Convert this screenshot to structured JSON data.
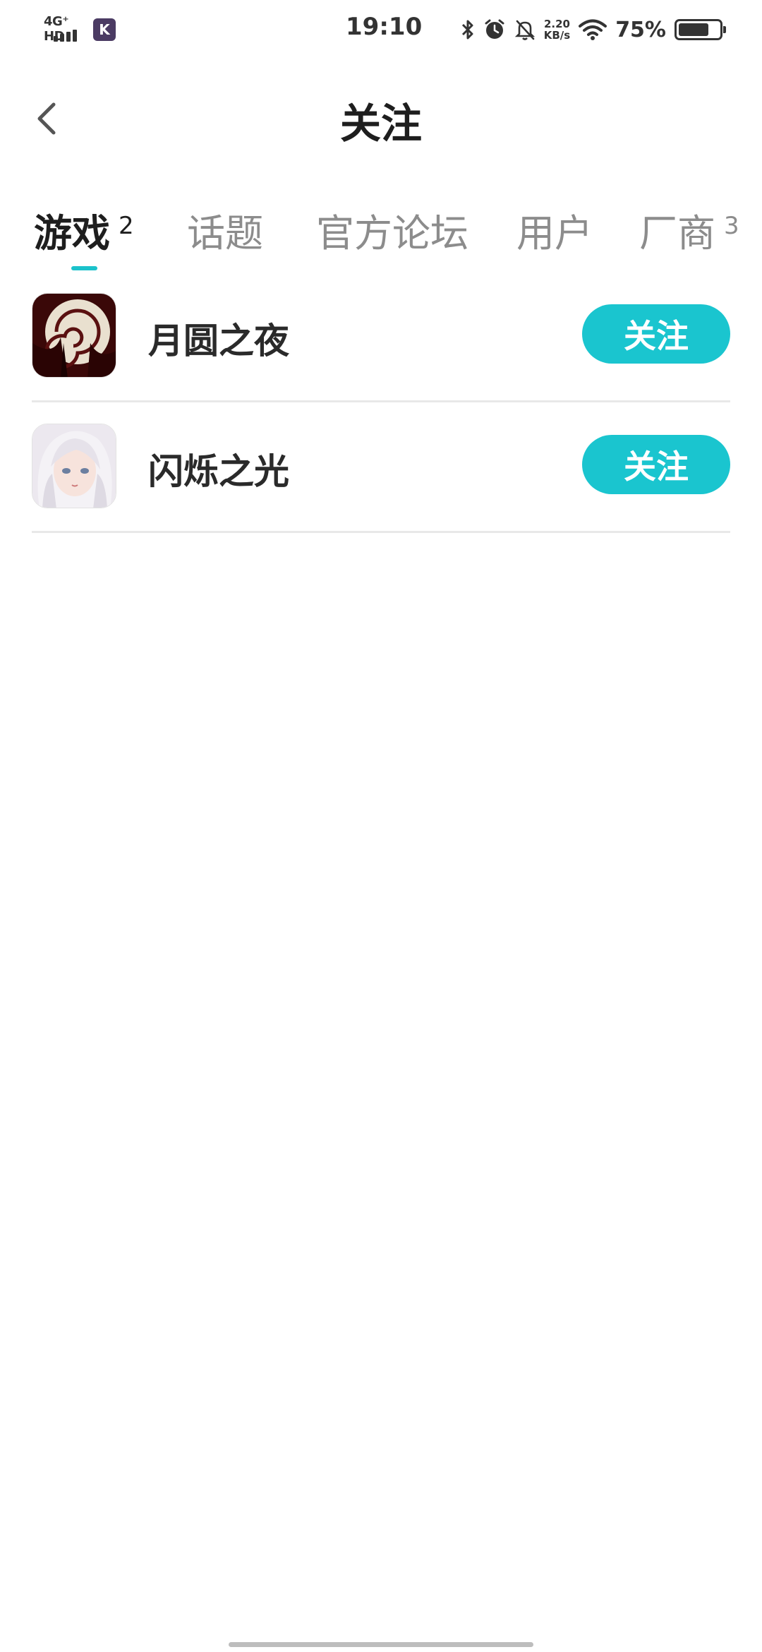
{
  "status_bar": {
    "network": "4G⁺ HD",
    "app_letter": "K",
    "time": "19:10",
    "speed_value": "2.20",
    "speed_unit": "KB/s",
    "battery_pct": "75%",
    "battery_level": 0.75
  },
  "header": {
    "title": "关注"
  },
  "tabs": [
    {
      "label": "游戏",
      "count": "2",
      "active": true
    },
    {
      "label": "话题"
    },
    {
      "label": "官方论坛"
    },
    {
      "label": "用户"
    },
    {
      "label": "厂商",
      "count": "3"
    }
  ],
  "games": [
    {
      "name": "月圆之夜",
      "button": "关注",
      "icon": "moon-night-game-icon"
    },
    {
      "name": "闪烁之光",
      "button": "关注",
      "icon": "anime-girl-game-icon"
    }
  ],
  "colors": {
    "accent": "#1ac5cf",
    "text_primary": "#1e1e1e",
    "text_secondary": "#8c8c8c",
    "divider": "#e8e8e8"
  }
}
